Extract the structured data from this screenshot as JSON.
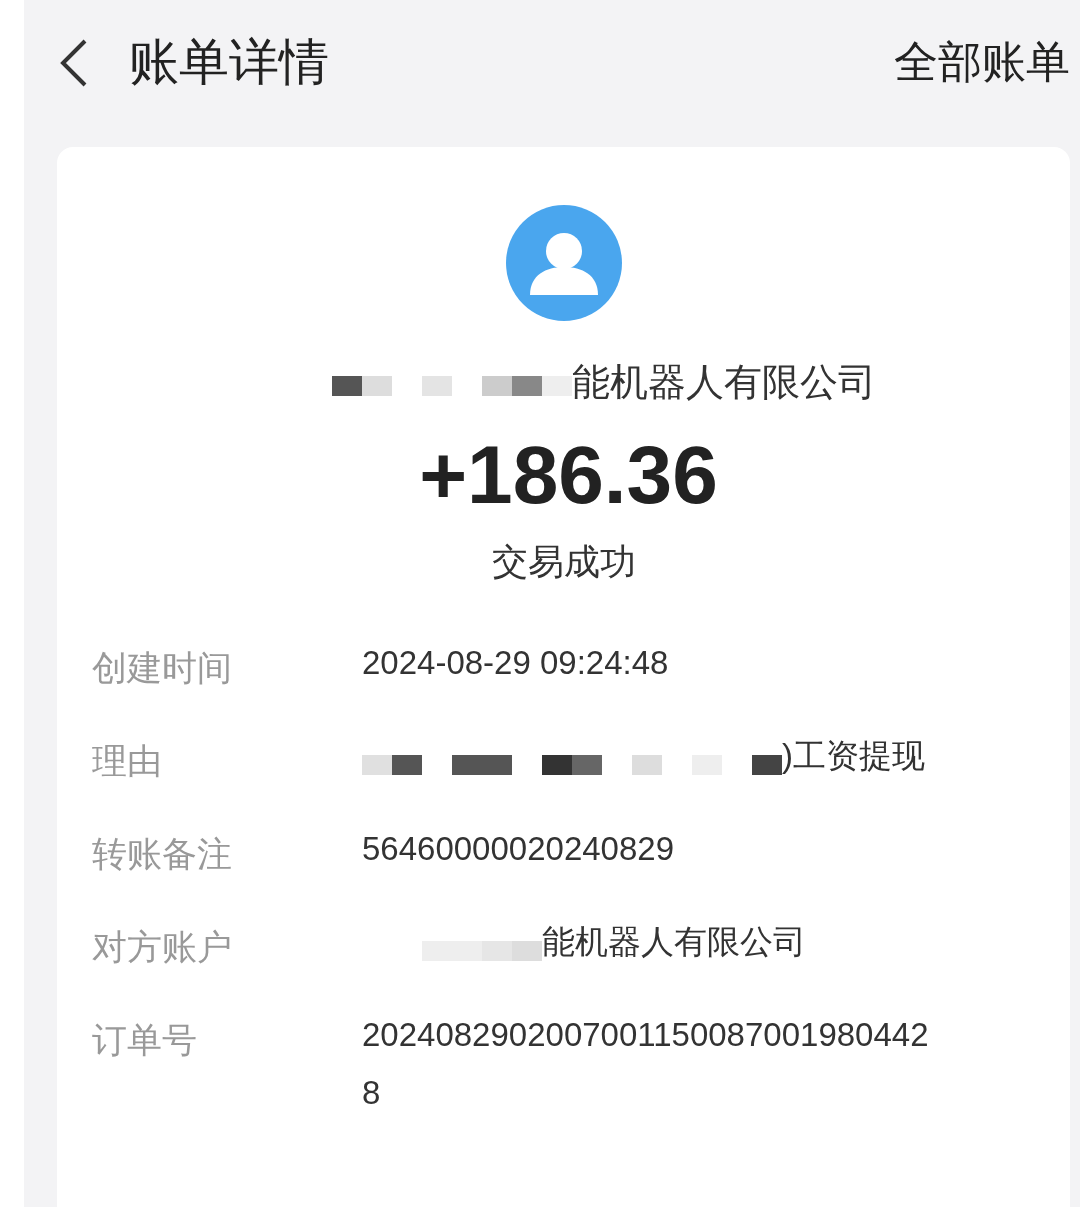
{
  "header": {
    "title": "账单详情",
    "action": "全部账单"
  },
  "payee": {
    "name": "能机器人有限公司",
    "redacted": true
  },
  "amount": "+186.36",
  "status": "交易成功",
  "details": [
    {
      "label": "创建时间",
      "value": "2024-08-29 09:24:48",
      "redacted": false
    },
    {
      "label": "理由",
      "value": ")工资提现",
      "redacted": true
    },
    {
      "label": "转账备注",
      "value": "56460000020240829",
      "redacted": false
    },
    {
      "label": "对方账户",
      "value": "能机器人有限公司",
      "redacted": true
    },
    {
      "label": "订单号",
      "value": "20240829020070011500870019804428",
      "redacted": false
    }
  ]
}
